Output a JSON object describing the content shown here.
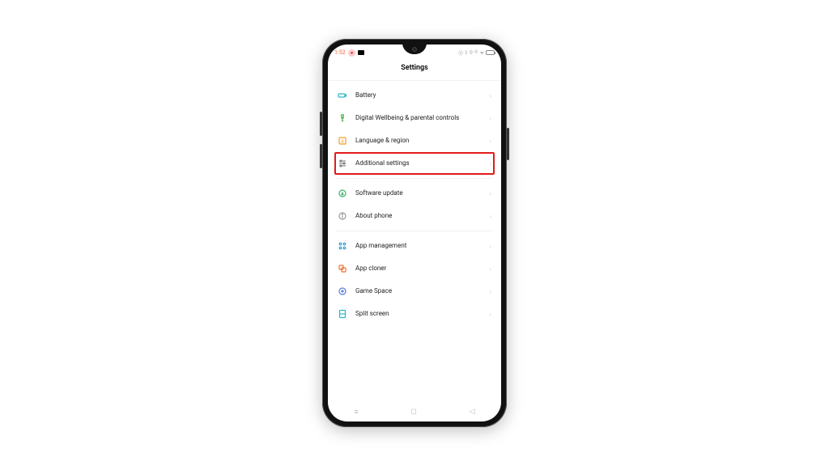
{
  "statusbar": {
    "time": "1:52",
    "mic": "●",
    "video": "▶"
  },
  "header": {
    "title": "Settings"
  },
  "groups": [
    {
      "rows": [
        {
          "id": "battery",
          "label": "Battery",
          "icon": "battery-icon",
          "color": "#2bb6c6"
        },
        {
          "id": "wellbeing",
          "label": "Digital Wellbeing & parental controls",
          "icon": "wellbeing-icon",
          "color": "#4caf50"
        },
        {
          "id": "language",
          "label": "Language & region",
          "icon": "language-icon",
          "color": "#f0a020"
        },
        {
          "id": "additional",
          "label": "Additional settings",
          "icon": "sliders-icon",
          "color": "#888",
          "highlight": true
        }
      ]
    },
    {
      "rows": [
        {
          "id": "software",
          "label": "Software update",
          "icon": "update-icon",
          "color": "#3bb36b"
        },
        {
          "id": "about",
          "label": "About phone",
          "icon": "info-icon",
          "color": "#999"
        }
      ]
    },
    {
      "rows": [
        {
          "id": "appmgmt",
          "label": "App management",
          "icon": "apps-icon",
          "color": "#2a9bd6"
        },
        {
          "id": "appcloner",
          "label": "App cloner",
          "icon": "clone-icon",
          "color": "#f07030"
        },
        {
          "id": "gamespace",
          "label": "Game Space",
          "icon": "game-icon",
          "color": "#5b7ad6"
        },
        {
          "id": "split",
          "label": "Split screen",
          "icon": "split-icon",
          "color": "#2bb6c6"
        }
      ]
    }
  ],
  "nav": {
    "recent": "≡",
    "home": "◻",
    "back": "◁"
  }
}
